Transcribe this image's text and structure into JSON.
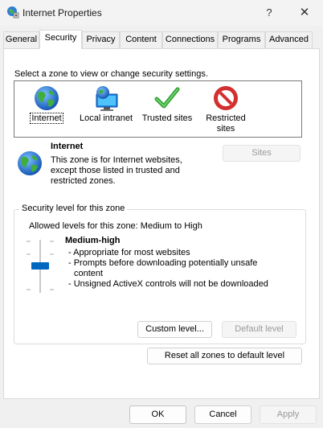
{
  "window": {
    "title": "Internet Properties",
    "help_glyph": "?",
    "close_glyph": "✕"
  },
  "tabs": [
    {
      "label": "General"
    },
    {
      "label": "Security",
      "active": true
    },
    {
      "label": "Privacy"
    },
    {
      "label": "Content"
    },
    {
      "label": "Connections"
    },
    {
      "label": "Programs"
    },
    {
      "label": "Advanced"
    }
  ],
  "security": {
    "zone_prompt": "Select a zone to view or change security settings.",
    "zones": [
      {
        "label": "Internet",
        "icon": "globe-icon",
        "selected": true
      },
      {
        "label": "Local intranet",
        "icon": "computer-globe-icon"
      },
      {
        "label": "Trusted sites",
        "icon": "checkmark-icon"
      },
      {
        "label": "Restricted sites",
        "icon": "restricted-icon"
      }
    ],
    "selected_zone": {
      "title": "Internet",
      "description": "This zone is for Internet websites, except those listed in trusted and restricted zones.",
      "icon": "globe-icon"
    },
    "sites_button": "Sites",
    "group_label": "Security level for this zone",
    "allowed_levels": "Allowed levels for this zone: Medium to High",
    "level_name": "Medium-high",
    "level_bullets": [
      "- Appropriate for most websites",
      "- Prompts before downloading potentially unsafe content",
      "- Unsigned ActiveX controls will not be downloaded"
    ],
    "custom_level_button": "Custom level...",
    "default_level_button": "Default level",
    "reset_zones_button": "Reset all zones to default level"
  },
  "footer": {
    "ok": "OK",
    "cancel": "Cancel",
    "apply": "Apply"
  },
  "colors": {
    "accent": "#0067c0",
    "window_bg": "#f0f0f0",
    "panel_bg": "#ffffff"
  }
}
